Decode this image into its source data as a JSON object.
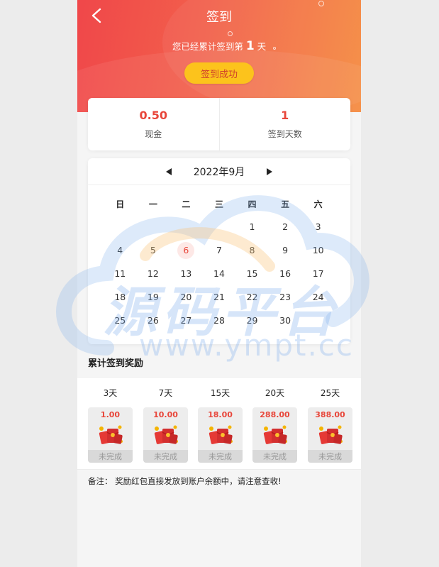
{
  "header": {
    "title": "签到",
    "streak_prefix": "您已经累计签到第",
    "streak_days": "1",
    "streak_suffix": "天",
    "sign_button": "签到成功"
  },
  "stats": [
    {
      "value": "0.50",
      "label": "现金"
    },
    {
      "value": "1",
      "label": "签到天数"
    }
  ],
  "calendar": {
    "month_label": "2022年9月",
    "weekdays": [
      "日",
      "一",
      "二",
      "三",
      "四",
      "五",
      "六"
    ],
    "days": [
      "1",
      "2",
      "3",
      "4",
      "5",
      "6",
      "7",
      "8",
      "9",
      "10",
      "11",
      "12",
      "13",
      "14",
      "15",
      "16",
      "17",
      "18",
      "19",
      "20",
      "21",
      "22",
      "23",
      "24",
      "25",
      "26",
      "27",
      "28",
      "29",
      "30"
    ],
    "today": "6"
  },
  "rewards": {
    "title": "累计签到奖励",
    "items": [
      {
        "days": "3天",
        "amount": "1.00",
        "status": "未完成"
      },
      {
        "days": "7天",
        "amount": "10.00",
        "status": "未完成"
      },
      {
        "days": "15天",
        "amount": "18.00",
        "status": "未完成"
      },
      {
        "days": "20天",
        "amount": "288.00",
        "status": "未完成"
      },
      {
        "days": "25天",
        "amount": "388.00",
        "status": "未完成"
      }
    ]
  },
  "note": "备注： 奖励红包直接发放到账户余额中，请注意查收!",
  "watermark": {
    "text_cn": "源码平台",
    "text_en": "www.ympt.cc"
  },
  "colors": {
    "accent": "#e8463a",
    "button": "#fcc31c",
    "header_start": "#f0474a",
    "header_end": "#f58a3e"
  },
  "icons": {
    "back": "chevron-left-icon",
    "prev": "triangle-left-icon",
    "next": "triangle-right-icon",
    "reward": "red-packet-icon"
  }
}
